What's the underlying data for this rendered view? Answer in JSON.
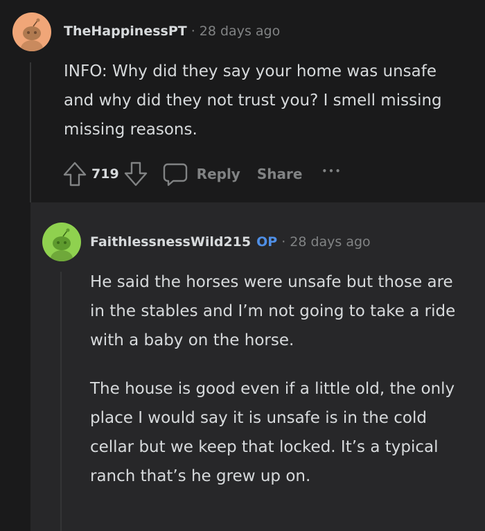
{
  "comment": {
    "username": "TheHappinessPT",
    "separator": "·",
    "time": "28 days ago",
    "body": "INFO: Why did they say your home was unsafe and why did they not trust you? I smell missing missing reasons.",
    "score": "719",
    "reply_label": "Reply",
    "share_label": "Share",
    "more_label": "•••",
    "avatar_color": "#f0a678"
  },
  "reply": {
    "username": "FaithlessnessWild215",
    "op_badge": "OP",
    "separator": "·",
    "time": "28 days ago",
    "paragraphs": [
      "He said the horses were unsafe but those are in the stables and I’m not going to take a ride with a baby on the horse.",
      "The house is good even if a little old, the only place I would say it is unsafe is in the cold cellar but we keep that locked. It’s a typical ranch that’s he grew up on."
    ],
    "avatar_color": "#8fd14f"
  }
}
